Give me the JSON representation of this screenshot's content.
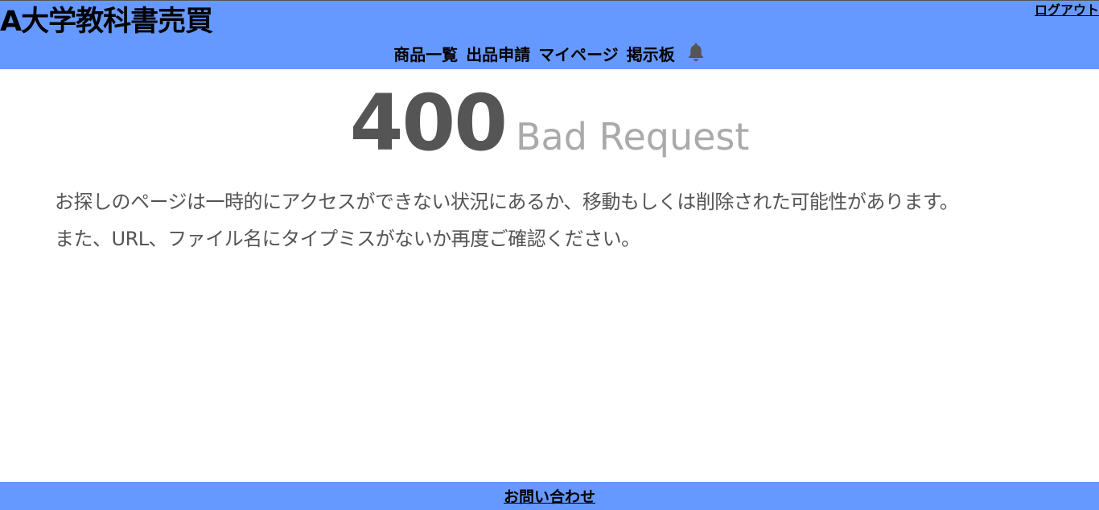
{
  "header": {
    "site_title": "A大学教科書売買",
    "logout_label": "ログアウト",
    "nav": {
      "items": [
        {
          "label": "商品一覧"
        },
        {
          "label": "出品申請"
        },
        {
          "label": "マイページ"
        },
        {
          "label": "掲示板"
        }
      ],
      "notification_icon": "bell-icon"
    }
  },
  "error": {
    "code": "400",
    "text": "Bad Request",
    "message_lines": [
      "お探しのページは一時的にアクセスができない状況にあるか、移動もしくは削除された可能性があります。",
      "また、URL、ファイル名にタイプミスがないか再度ご確認ください。"
    ]
  },
  "footer": {
    "contact_label": "お問い合わせ"
  },
  "colors": {
    "brand": "#6699ff",
    "error_code": "#555555",
    "error_text": "#aaaaaa",
    "message_text": "#555555"
  }
}
